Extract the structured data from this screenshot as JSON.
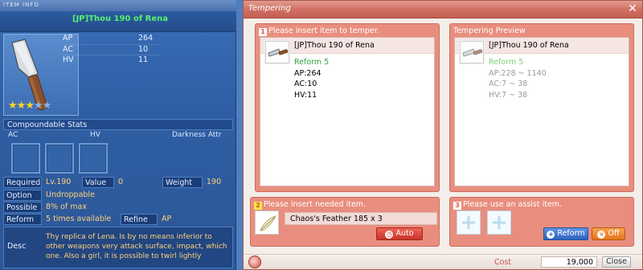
{
  "item_info": {
    "window_title": "ITEM INFO",
    "item_name": "[JP]Thou 190 of Rena",
    "stats": [
      {
        "key": "AP",
        "value": "264"
      },
      {
        "key": "AC",
        "value": "10"
      },
      {
        "key": "HV",
        "value": "11"
      }
    ],
    "stars": {
      "filled": 3,
      "total": 5
    },
    "compoundable_label": "Compoundable Stats",
    "compound_columns": [
      "AC",
      "HV",
      "Darkness Attr"
    ],
    "required_label": "Required",
    "required_value": "Lv.190",
    "value_label": "Value",
    "value_value": "0",
    "weight_label": "Weight",
    "weight_value": "190",
    "option_label": "Option",
    "option_value": "Undroppable",
    "possible_label": "Possible",
    "possible_value": "8% of max",
    "reform_label": "Reform",
    "reform_value": "5 times available",
    "refine_label": "Refine",
    "refine_value": "AP",
    "desc_label": "Desc",
    "desc_text": "Thy replica of Lena. Is by no means inferior to other weapons very attack surface, impact, which one. Also a girl, it is possible to twirl lightly"
  },
  "tempering": {
    "window_title": "Tempering",
    "panel1": {
      "num": "1",
      "title": "Please insert item to temper.",
      "item_name": "[JP]Thou 190 of Rena",
      "lines": [
        "Reform 5",
        "AP:264",
        "AC:10",
        "HV:11"
      ]
    },
    "preview": {
      "title": "Tempering Preview",
      "item_name": "[JP]Thou 190 of Rena",
      "lines": [
        "Reform 5",
        "AP:228 ~ 1140",
        "AC:7 ~ 38",
        "HV:7 ~ 38"
      ]
    },
    "panel2": {
      "num": "2",
      "title": "Please insert needed item.",
      "ingredient": "Chaos's Feather 185 x 3",
      "auto_label": "Auto"
    },
    "panel3": {
      "num": "3",
      "title": "Please use an assist item.",
      "reform_label": "Reform",
      "off_label": "Off"
    },
    "footer": {
      "cost_label": "Cost",
      "cost_value": "19,000",
      "close_label": "Close"
    }
  },
  "colors": {
    "accent": "#e98e7e",
    "item_name_green": "#56f06c",
    "value_gold": "#ffd07a"
  }
}
